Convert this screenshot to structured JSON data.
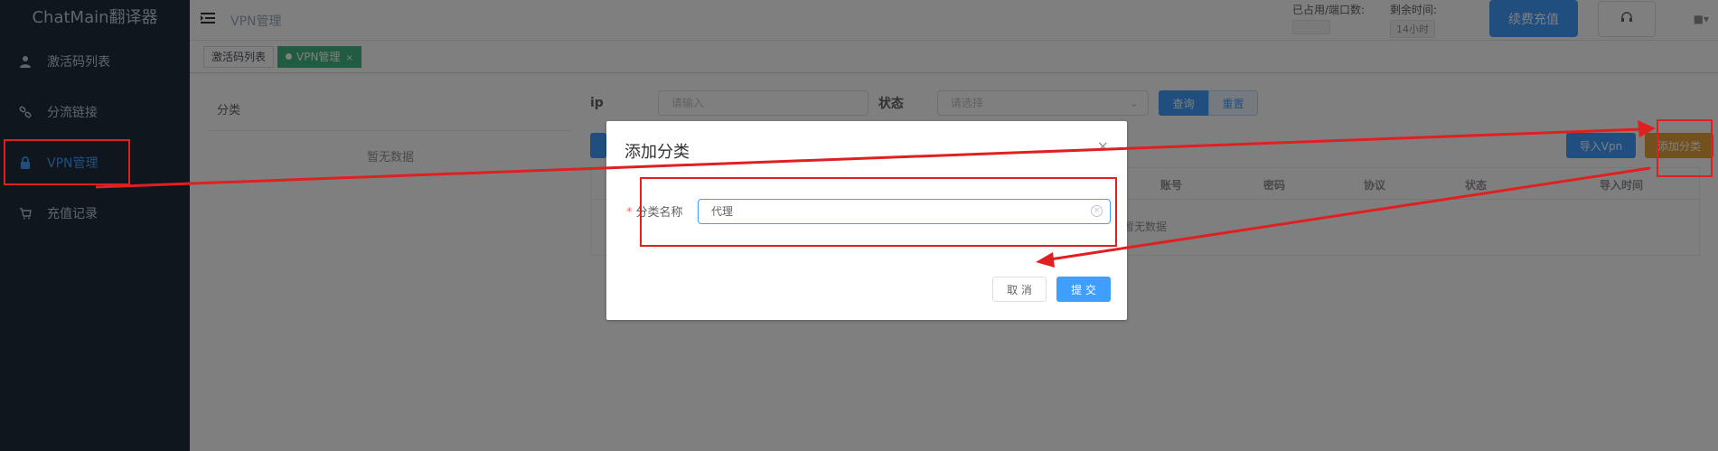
{
  "app": {
    "title": "ChatMain翻译器"
  },
  "sidebar": {
    "items": [
      {
        "label": "激活码列表",
        "icon": "user-icon"
      },
      {
        "label": "分流链接",
        "icon": "link-icon"
      },
      {
        "label": "VPN管理",
        "icon": "lock-icon",
        "active": true
      },
      {
        "label": "充值记录",
        "icon": "cart-icon"
      }
    ]
  },
  "header": {
    "breadcrumb": "VPN管理",
    "port_label": "已占用/端口数:",
    "time_label": "剩余时间:",
    "time_value": "14小时",
    "renew_label": "续费充值",
    "support_icon": "headset-icon"
  },
  "tags": [
    {
      "label": "激活码列表"
    },
    {
      "label": "VPN管理",
      "close": "×",
      "active": true
    }
  ],
  "category_panel": {
    "title": "分类",
    "empty": "暂无数据"
  },
  "filter": {
    "ip_label": "ip",
    "ip_placeholder": "请输入",
    "status_label": "状态",
    "status_placeholder": "请选择",
    "query_label": "查询",
    "reset_label": "重置"
  },
  "actions": {
    "import_vpn": "导入Vpn",
    "add_category": "添加分类"
  },
  "table": {
    "columns": [
      "账号",
      "密码",
      "协议",
      "状态",
      "导入时间"
    ],
    "empty": "暂无数据"
  },
  "dialog": {
    "title": "添加分类",
    "close": "×",
    "required_mark": "*",
    "field_label": "分类名称",
    "field_value": "代理",
    "cancel_label": "取 消",
    "submit_label": "提 交"
  },
  "colors": {
    "sidebar_bg": "#1f2d3d",
    "primary": "#409eff",
    "tag_active": "#42b983",
    "annotation_red": "#e02020",
    "add_category_button": "#e6a23c"
  }
}
